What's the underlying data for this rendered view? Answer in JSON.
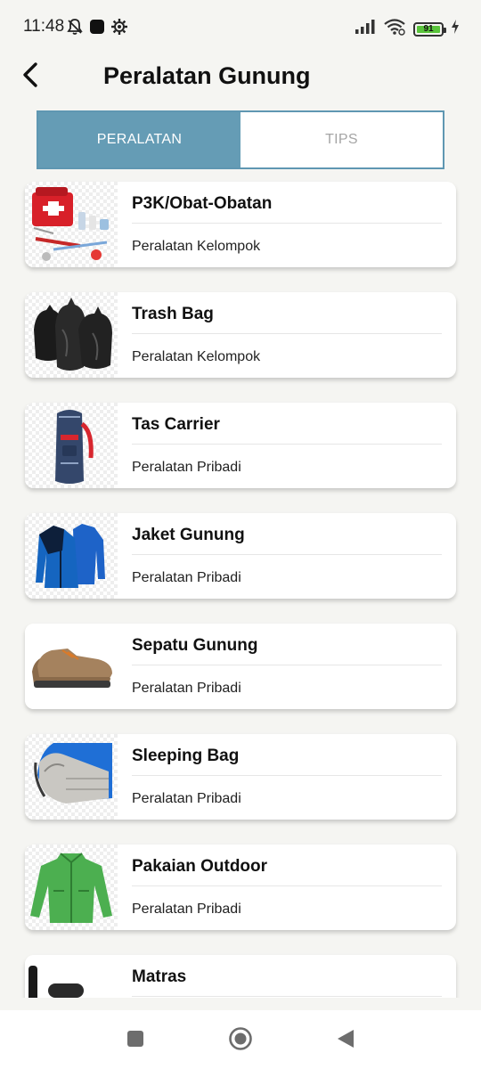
{
  "status_bar": {
    "time": "11:48",
    "battery": "91",
    "battery_level": 0.91,
    "icons": [
      "bell-off-icon",
      "square-app-icon",
      "settings-gear-icon",
      "signal-icon",
      "wifi-icon",
      "battery-icon",
      "charging-icon"
    ]
  },
  "header": {
    "title": "Peralatan Gunung",
    "back_icon": "back-arrow-icon"
  },
  "tabs": [
    {
      "label": "PERALATAN",
      "active": true
    },
    {
      "label": "TIPS",
      "active": false
    }
  ],
  "items": [
    {
      "name": "P3K/Obat-Obatan",
      "category": "Peralatan Kelompok",
      "icon": "first-aid-kit-icon"
    },
    {
      "name": "Trash Bag",
      "category": "Peralatan Kelompok",
      "icon": "trash-bag-icon"
    },
    {
      "name": "Tas Carrier",
      "category": "Peralatan Pribadi",
      "icon": "backpack-icon"
    },
    {
      "name": "Jaket Gunung",
      "category": "Peralatan Pribadi",
      "icon": "jacket-icon"
    },
    {
      "name": "Sepatu Gunung",
      "category": "Peralatan Pribadi",
      "icon": "hiking-boot-icon"
    },
    {
      "name": "Sleeping Bag",
      "category": "Peralatan Pribadi",
      "icon": "sleeping-bag-icon"
    },
    {
      "name": "Pakaian Outdoor",
      "category": "Peralatan Pribadi",
      "icon": "outdoor-jacket-icon"
    },
    {
      "name": "Matras",
      "category": "",
      "icon": "mat-icon"
    }
  ],
  "nav_bar": {
    "icons": [
      "recent-apps-icon",
      "home-icon",
      "back-icon"
    ]
  }
}
